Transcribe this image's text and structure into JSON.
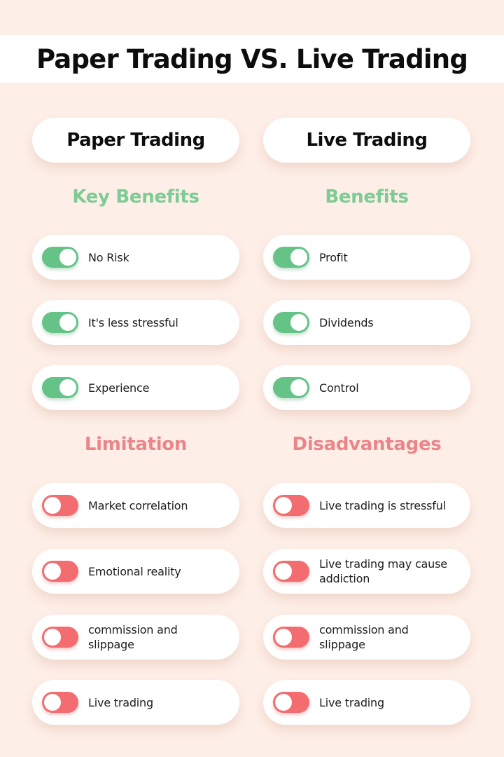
{
  "title": "Paper Trading VS. Live Trading",
  "colors": {
    "background": "#fdeee7",
    "positive": "#66c388",
    "negative": "#f36c6f",
    "positive_heading": "#7ecb95",
    "negative_heading": "#ec8589"
  },
  "columns": [
    {
      "header": "Paper Trading",
      "benefits_title": "Key Benefits",
      "benefits": [
        {
          "label": "No Risk",
          "toggle": "on"
        },
        {
          "label": "It's less stressful",
          "toggle": "on"
        },
        {
          "label": "Experience",
          "toggle": "on"
        }
      ],
      "drawbacks_title": "Limitation",
      "drawbacks": [
        {
          "label": "Market correlation",
          "toggle": "off"
        },
        {
          "label": "Emotional reality",
          "toggle": "off"
        },
        {
          "label": "commission and slippage",
          "toggle": "off"
        },
        {
          "label": "Live trading",
          "toggle": "off"
        }
      ]
    },
    {
      "header": "Live Trading",
      "benefits_title": "Benefits",
      "benefits": [
        {
          "label": "Profit",
          "toggle": "on"
        },
        {
          "label": "Dividends",
          "toggle": "on"
        },
        {
          "label": "Control",
          "toggle": "on"
        }
      ],
      "drawbacks_title": "Disadvantages",
      "drawbacks": [
        {
          "label": "Live trading is stressful",
          "toggle": "off"
        },
        {
          "label": "Live trading may cause addiction",
          "toggle": "off"
        },
        {
          "label": "commission and slippage",
          "toggle": "off"
        },
        {
          "label": "Live trading",
          "toggle": "off"
        }
      ]
    }
  ]
}
